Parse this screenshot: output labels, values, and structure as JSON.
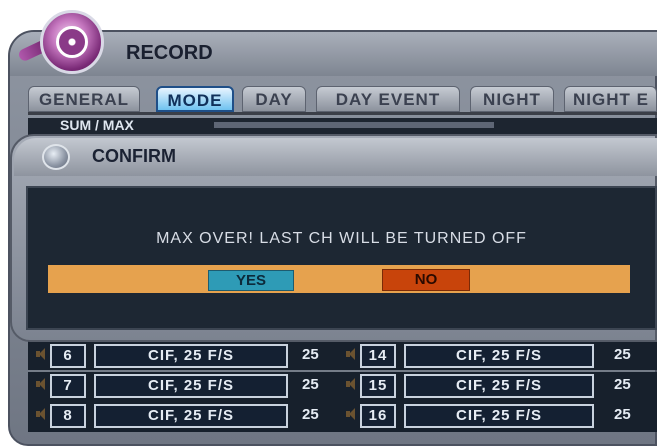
{
  "record": {
    "title": "RECORD",
    "tabs": [
      {
        "label": "GENERAL"
      },
      {
        "label": "MODE"
      },
      {
        "label": "DAY"
      },
      {
        "label": "DAY EVENT"
      },
      {
        "label": "NIGHT"
      },
      {
        "label": "NIGHT E"
      }
    ],
    "active_tab": "MODE",
    "top_row_label": "SUM / MAX",
    "rows": [
      {
        "ch": "6",
        "left_res": "CIF, 25 F/S",
        "left_fps": "25",
        "ch2": "14",
        "right_res": "CIF, 25 F/S",
        "right_fps": "25"
      },
      {
        "ch": "7",
        "left_res": "CIF, 25 F/S",
        "left_fps": "25",
        "ch2": "15",
        "right_res": "CIF, 25 F/S",
        "right_fps": "25"
      },
      {
        "ch": "8",
        "left_res": "CIF, 25 F/S",
        "left_fps": "25",
        "ch2": "16",
        "right_res": "CIF, 25 F/S",
        "right_fps": "25"
      }
    ]
  },
  "confirm": {
    "title": "CONFIRM",
    "message": "MAX OVER! LAST CH WILL BE TURNED OFF",
    "yes_label": "YES",
    "no_label": "NO"
  },
  "colors": {
    "tab_active": "#6fc2f0",
    "button_bar": "#e6a24e",
    "yes": "#2e9bb6",
    "no": "#c8440b",
    "panel_dark": "#1d2733"
  }
}
